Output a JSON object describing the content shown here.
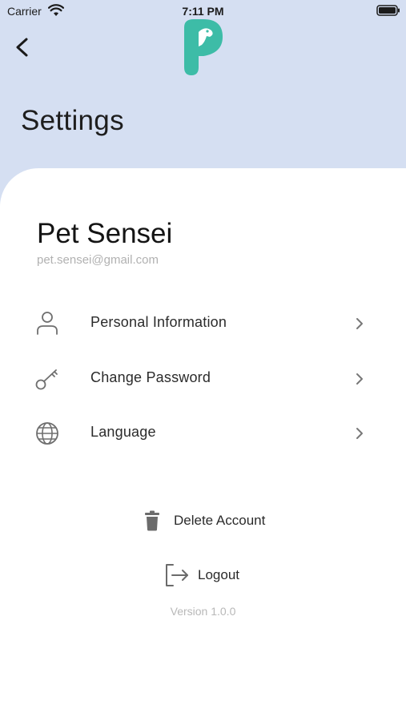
{
  "status_bar": {
    "carrier": "Carrier",
    "time": "7:11 PM"
  },
  "header": {
    "title": "Settings"
  },
  "colors": {
    "header_bg": "#d5dff2",
    "logo": "#3dbca7",
    "icon": "#6f6f6f"
  },
  "profile": {
    "name": "Pet Sensei",
    "email": "pet.sensei@gmail.com"
  },
  "menu": {
    "items": [
      {
        "label": "Personal Information",
        "icon": "person-icon"
      },
      {
        "label": "Change Password",
        "icon": "key-icon"
      },
      {
        "label": "Language",
        "icon": "globe-icon"
      }
    ]
  },
  "actions": {
    "delete_label": "Delete Account",
    "logout_label": "Logout"
  },
  "footer": {
    "version": "Version 1.0.0"
  }
}
